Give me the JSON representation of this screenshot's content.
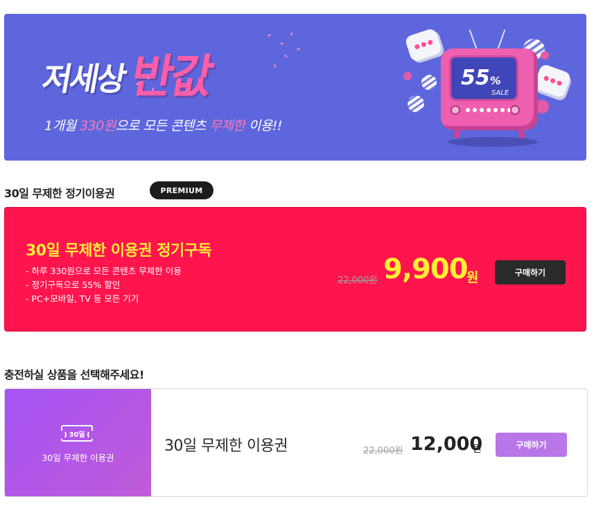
{
  "banner": {
    "title_white": "저세상",
    "title_pink": "반값",
    "subtitle_pre": "1개월 ",
    "subtitle_price": "330원",
    "subtitle_mid": "으로 모든 콘텐츠 ",
    "subtitle_unlimited": "무제한",
    "subtitle_post": " 이용!!",
    "tv_discount": "55",
    "tv_percent": "%",
    "tv_sale": "SALE"
  },
  "premium_section": {
    "heading": "30일 무제한 정기이용권",
    "badge": "PREMIUM"
  },
  "premium_card": {
    "title": "30일 무제한 이용권 정기구독",
    "features": [
      "- 하루 330원으로 모든 콘텐츠 무제한 이용",
      "- 정기구독으로 55% 할인",
      "- PC+모바일, TV 등 모든 기기"
    ],
    "original_price": "22,000원",
    "price": "9,900",
    "currency": "원",
    "buy_label": "구매하기"
  },
  "charge_section": {
    "heading": "충전하실 상품을 선택해주세요!"
  },
  "product": {
    "ticket_label": "30일",
    "left_label": "30일 무제한 이용권",
    "name": "30일 무제한 이용권",
    "original_price": "22,000원",
    "price": "12,000",
    "currency": "원",
    "buy_label": "구매하기"
  },
  "colors": {
    "banner_bg": "#5d66dc",
    "brand_pink": "#ff5ea8",
    "premium_red": "#ff154e",
    "premium_yellow": "#ffee38",
    "product_purple": "#a553f5",
    "button_purple": "#b876e8"
  },
  "icons": [
    "confetti-icon",
    "chat-bubble-icon",
    "tv-icon",
    "ticket-icon"
  ]
}
